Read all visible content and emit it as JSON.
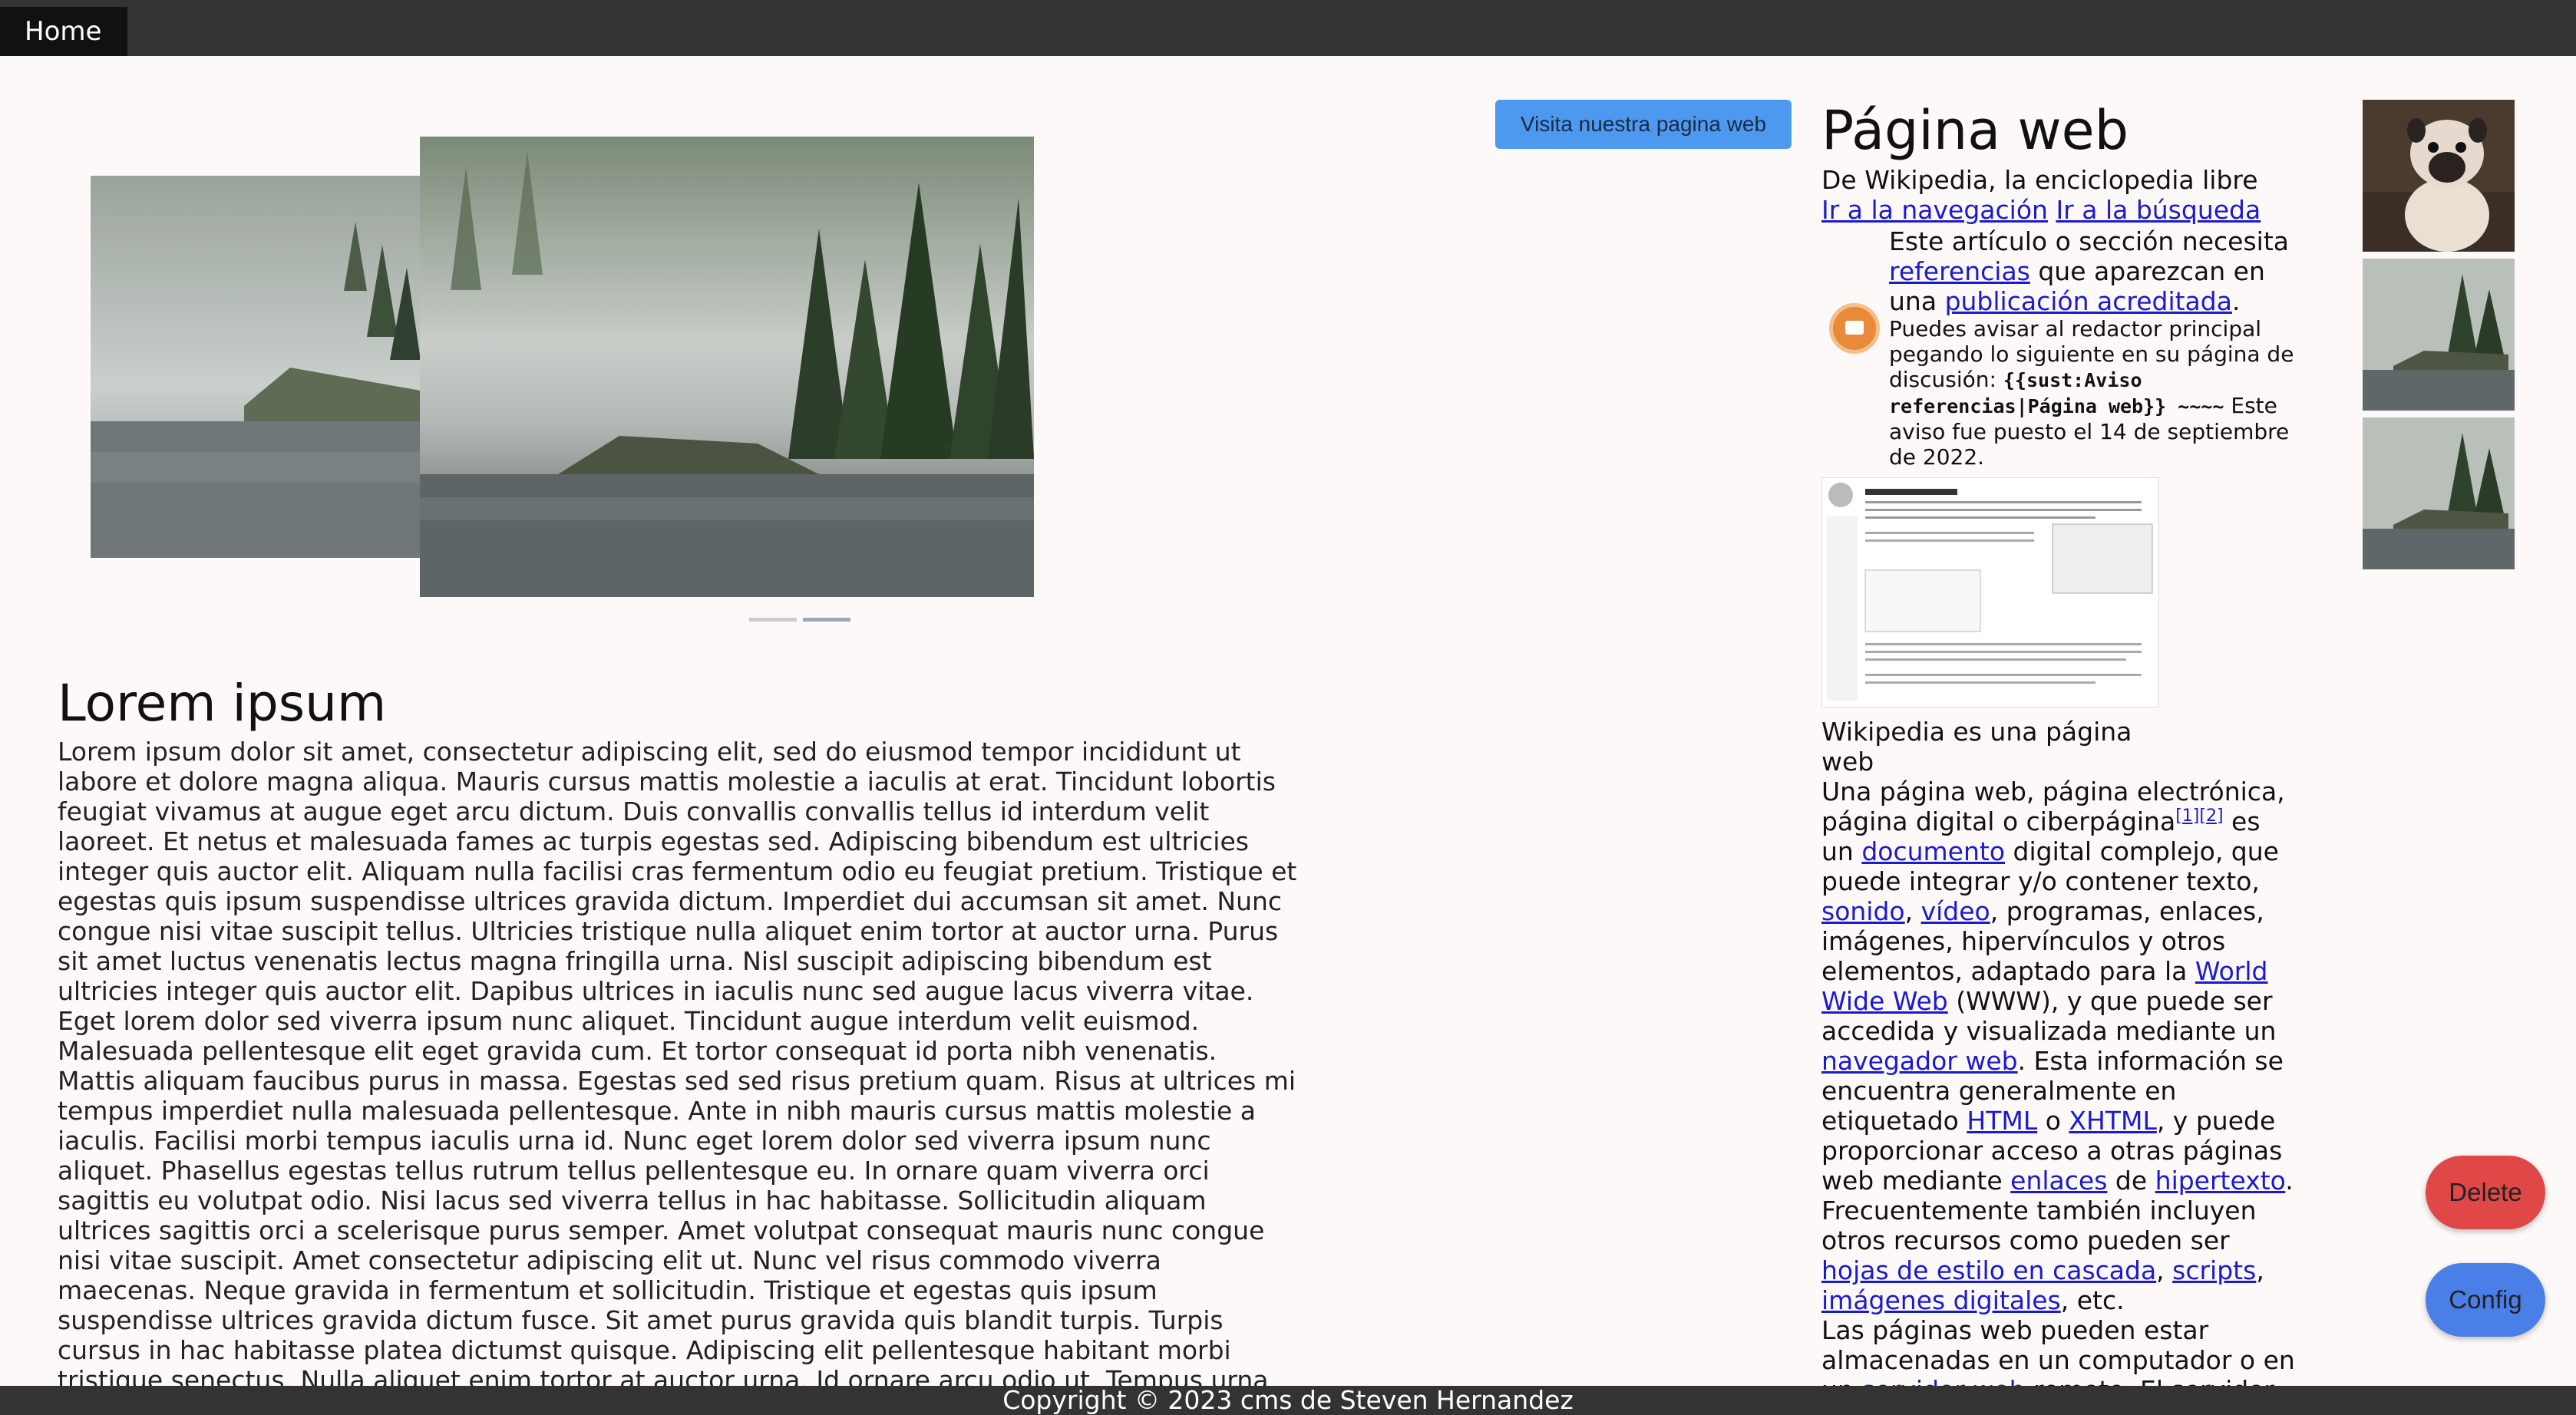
{
  "nav": {
    "home_label": "Home"
  },
  "cta": {
    "label": "Visita nuestra pagina web"
  },
  "slider": {
    "slide_count": 2,
    "active_index": 1
  },
  "main": {
    "title": "Lorem ipsum",
    "body": "Lorem ipsum dolor sit amet, consectetur adipiscing elit, sed do eiusmod tempor incididunt ut labore et dolore magna aliqua. Mauris cursus mattis molestie a iaculis at erat. Tincidunt lobortis feugiat vivamus at augue eget arcu dictum. Duis convallis convallis tellus id interdum velit laoreet. Et netus et malesuada fames ac turpis egestas sed. Adipiscing bibendum est ultricies integer quis auctor elit. Aliquam nulla facilisi cras fermentum odio eu feugiat pretium. Tristique et egestas quis ipsum suspendisse ultrices gravida dictum. Imperdiet dui accumsan sit amet. Nunc congue nisi vitae suscipit tellus. Ultricies tristique nulla aliquet enim tortor at auctor urna. Purus sit amet luctus venenatis lectus magna fringilla urna. Nisl suscipit adipiscing bibendum est ultricies integer quis auctor elit. Dapibus ultrices in iaculis nunc sed augue lacus viverra vitae. Eget lorem dolor sed viverra ipsum nunc aliquet. Tincidunt augue interdum velit euismod. Malesuada pellentesque elit eget gravida cum. Et tortor consequat id porta nibh venenatis. Mattis aliquam faucibus purus in massa. Egestas sed sed risus pretium quam. Risus at ultrices mi tempus imperdiet nulla malesuada pellentesque. Ante in nibh mauris cursus mattis molestie a iaculis. Facilisi morbi tempus iaculis urna id. Nunc eget lorem dolor sed viverra ipsum nunc aliquet. Phasellus egestas tellus rutrum tellus pellentesque eu. In ornare quam viverra orci sagittis eu volutpat odio. Nisi lacus sed viverra tellus in hac habitasse. Sollicitudin aliquam ultrices sagittis orci a scelerisque purus semper. Amet volutpat consequat mauris nunc congue nisi vitae suscipit. Amet consectetur adipiscing elit ut. Nunc vel risus commodo viverra maecenas. Neque gravida in fermentum et sollicitudin. Tristique et egestas quis ipsum suspendisse ultrices gravida dictum fusce. Sit amet purus gravida quis blandit turpis. Turpis cursus in hac habitasse platea dictumst quisque. Adipiscing elit pellentesque habitant morbi tristique senectus. Nulla aliquet enim tortor at auctor urna. Id ornare arcu odio ut. Tempus urna et pharetra pharetra massa massa. Consectetur a erat nam at lectus urna duis convallis convallis."
  },
  "wiki": {
    "title": "Página web",
    "subtitle": "De Wikipedia, la enciclopedia libre",
    "nav_link": "Ir a la navegación",
    "search_link": "Ir a la búsqueda",
    "notice": {
      "text_1": "Este artículo o sección necesita",
      "link_refs": "referencias",
      "text_2": "que aparezcan en una",
      "link_pub": "publicación acreditada",
      "text_3": ".",
      "small_1": "Puedes avisar al redactor principal pegando lo siguiente en su página de discusión:",
      "code": "{{sust:Aviso referencias|Página web}} ~~~~",
      "small_2": "Este aviso fue puesto el 14 de septiembre de 2022."
    },
    "caption": "Wikipedia es una página web",
    "para": {
      "t1": "Una página web, página electrónica, página digital o ciberpágina",
      "ref1": "[1]",
      "ref2": "[2]",
      "t2": " es un ",
      "l_documento": "documento",
      "t3": " digital complejo, que puede integrar y/o contener texto, ",
      "l_sonido": "sonido",
      "t4": ", ",
      "l_video": "vídeo",
      "t5": ", programas, enlaces, imágenes, hipervínculos y otros elementos, adaptado para la ",
      "l_www": "World Wide Web",
      "t6": " (WWW), y que puede ser accedida y visualizada mediante un ",
      "l_navegador": "navegador web",
      "t7": ". Esta información se encuentra generalmente en etiquetado ",
      "l_html": "HTML",
      "t8": " o ",
      "l_xhtml": "XHTML",
      "t9": ", y puede proporcionar acceso a otras páginas web mediante ",
      "l_enlaces": "enlaces",
      "t10": " de ",
      "l_hipertexto": "hipertexto",
      "t11": ". Frecuentemente también incluyen otros recursos como pueden ser ",
      "l_css": "hojas de estilo en cascada",
      "t12": ", ",
      "l_scripts": "scripts",
      "t13": ", ",
      "l_imagenes": "imágenes digitales",
      "t14": ", etc."
    },
    "para2": {
      "t1": "Las páginas web pueden estar almacenadas en un computador o en un ",
      "l_servidor": "servidor web",
      "t2": " remoto. El servidor"
    }
  },
  "buttons": {
    "delete_label": "Delete",
    "config_label": "Config"
  },
  "footer": {
    "text": "Copyright © 2023 cms de Steven Hernandez"
  },
  "colors": {
    "nav_bg": "#333333",
    "cta": "#4e99f0",
    "delete": "#e04848",
    "config": "#4a7fe8",
    "link": "#1a1ad0",
    "page_bg": "#fdf9f8"
  },
  "icons": [
    "book-notice-icon"
  ]
}
